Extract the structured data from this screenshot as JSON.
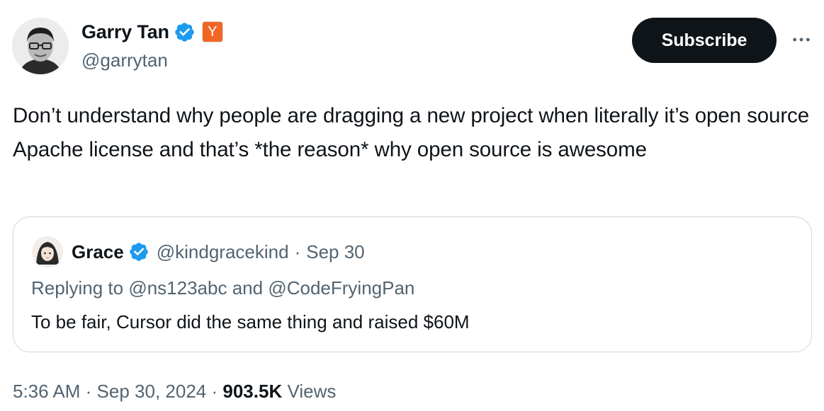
{
  "author": {
    "name": "Garry Tan",
    "handle": "@garrytan",
    "verified_icon": "verified-badge-icon",
    "affiliate_badge": "Y",
    "affiliate_color": "#f26625",
    "verified_color": "#1d9bf0"
  },
  "actions": {
    "subscribe_label": "Subscribe",
    "more_icon": "more-horizontal-icon"
  },
  "tweet": {
    "text": "Don’t understand why people are dragging a new project when literally it’s open source Apache license and that’s *the reason* why open source is awesome"
  },
  "quote": {
    "name": "Grace",
    "handle": "@kindgracekind",
    "separator": "·",
    "date": "Sep 30",
    "replying_prefix": "Replying to",
    "replying_to_1": "@ns123abc",
    "replying_and": "and",
    "replying_to_2": "@CodeFryingPan",
    "text": "To be fair, Cursor did the same thing and raised $60M"
  },
  "footer": {
    "time": "5:36 AM",
    "sep1": "·",
    "date": "Sep 30, 2024",
    "sep2": "·",
    "views_count": "903.5K",
    "views_label": "Views"
  }
}
